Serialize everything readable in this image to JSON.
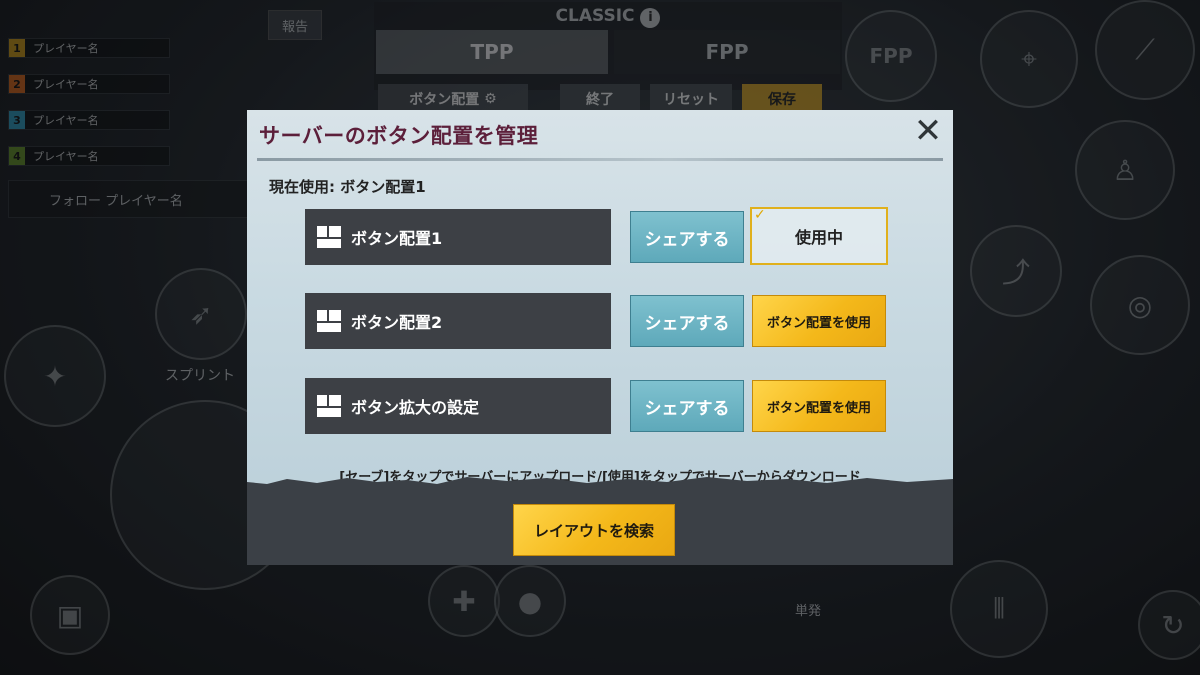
{
  "background": {
    "report_label": "報告",
    "players": [
      {
        "num": "1",
        "name": "プレイヤー名",
        "color": "#d4a017"
      },
      {
        "num": "2",
        "name": "プレイヤー名",
        "color": "#e06a1a"
      },
      {
        "num": "3",
        "name": "プレイヤー名",
        "color": "#2fa4c9"
      },
      {
        "num": "4",
        "name": "プレイヤー名",
        "color": "#6a9a2a"
      }
    ],
    "follow_label": "フォロー",
    "follow_player": "プレイヤー名",
    "mode_label": "CLASSIC",
    "mode_info": "i",
    "tpp_label": "TPP",
    "fpp_label": "FPP",
    "layout_label": "ボタン配置",
    "exit_label": "終了",
    "reset_label": "リセット",
    "save_label": "保存",
    "fpp_toggle": "FPP",
    "sprint_label": "スプリント",
    "single_label": "単発"
  },
  "dialog": {
    "title": "サーバーのボタン配置を管理",
    "close": "✕",
    "current_label": "現在使用: ボタン配置1",
    "rows": [
      {
        "name": "ボタン配置1",
        "share": "シェアする",
        "status": "使用中"
      },
      {
        "name": "ボタン配置2",
        "share": "シェアする",
        "action": "ボタン配置を使用"
      },
      {
        "name": "ボタン拡大の設定",
        "share": "シェアする",
        "action": "ボタン配置を使用"
      }
    ],
    "hint": "[セーブ]をタップでサーバーにアップロード/[使用]をタップでサーバーからダウンロード",
    "search_label": "レイアウトを検索"
  }
}
